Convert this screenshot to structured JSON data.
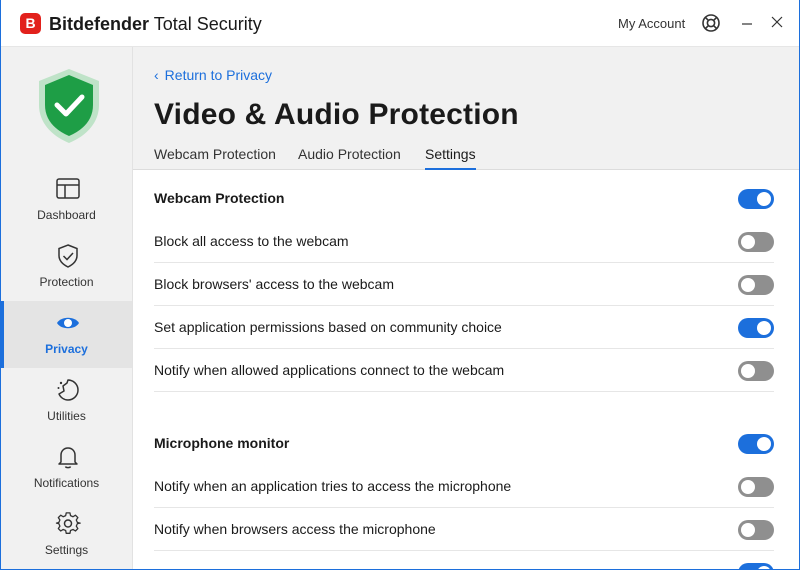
{
  "app": {
    "badge_letter": "B",
    "brand": "Bitdefender",
    "product": "Total Security",
    "my_account": "My Account",
    "colors": {
      "accent": "#1c6fdc",
      "brand_red": "#e2211c",
      "shield_green": "#1e9e46"
    }
  },
  "sidebar": {
    "items": [
      {
        "label": "Dashboard",
        "icon": "dashboard-icon"
      },
      {
        "label": "Protection",
        "icon": "shield-check-icon"
      },
      {
        "label": "Privacy",
        "icon": "eye-icon",
        "active": true
      },
      {
        "label": "Utilities",
        "icon": "utilities-icon"
      },
      {
        "label": "Notifications",
        "icon": "bell-icon"
      },
      {
        "label": "Settings",
        "icon": "gear-icon"
      }
    ]
  },
  "header": {
    "back_label": "Return to Privacy",
    "title": "Video & Audio Protection",
    "tabs": [
      {
        "label": "Webcam Protection"
      },
      {
        "label": "Audio Protection"
      },
      {
        "label": "Settings",
        "active": true
      }
    ]
  },
  "settings": {
    "webcam": {
      "title": "Webcam Protection",
      "enabled": true,
      "options": [
        {
          "label": "Block all access to the webcam",
          "enabled": false
        },
        {
          "label": "Block browsers' access to the webcam",
          "enabled": false
        },
        {
          "label": "Set application permissions based on community choice",
          "enabled": true
        },
        {
          "label": "Notify when allowed applications connect to the webcam",
          "enabled": false
        }
      ]
    },
    "microphone": {
      "title": "Microphone monitor",
      "enabled": true,
      "options": [
        {
          "label": "Notify when an application tries to access the microphone",
          "enabled": false
        },
        {
          "label": "Notify when browsers access the microphone",
          "enabled": false
        },
        {
          "label": "",
          "enabled": true
        }
      ]
    }
  }
}
